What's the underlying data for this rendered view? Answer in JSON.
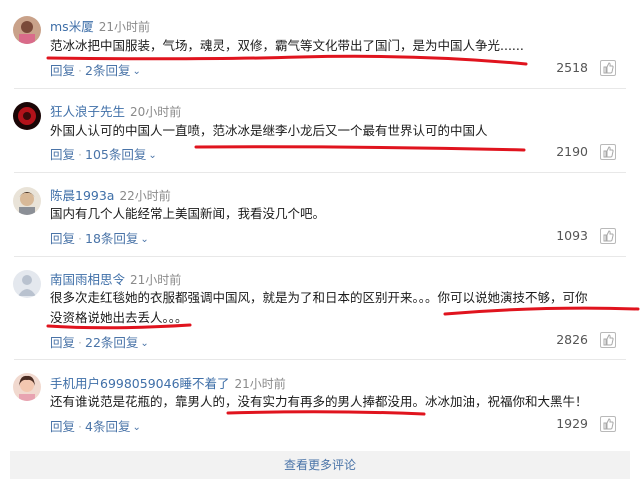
{
  "comments": [
    {
      "user": "ms米厦",
      "time": "21小时前",
      "text_lines": [
        "范冰冰把中国服装，气场，魂灵，双修，霸气等文化带出了国门，是为中国人争光......"
      ],
      "reply_label": "回复",
      "replies_label": "2条回复",
      "likes": "2518"
    },
    {
      "user": "狂人浪子先生",
      "time": "20小时前",
      "text_lines": [
        "外国人认可的中国人一直喷，范冰冰是继李小龙后又一个最有世界认可的中国人"
      ],
      "reply_label": "回复",
      "replies_label": "105条回复",
      "likes": "2190"
    },
    {
      "user": "陈晨1993a",
      "time": "22小时前",
      "text_lines": [
        "国内有几个人能经常上美国新闻，我看没几个吧。"
      ],
      "reply_label": "回复",
      "replies_label": "18条回复",
      "likes": "1093"
    },
    {
      "user": "南国雨相思令",
      "time": "21小时前",
      "text_lines": [
        "很多次走红毯她的衣服都强调中国风，就是为了和日本的区别开来。。。你可以说她演技不够，可你",
        "没资格说她出去丢人。。。"
      ],
      "reply_label": "回复",
      "replies_label": "22条回复",
      "likes": "2826"
    },
    {
      "user": "手机用户6998059046睡不着了",
      "time": "21小时前",
      "text_lines": [
        "还有谁说范是花瓶的，靠男人的，没有实力有再多的男人捧都没用。冰冰加油，祝福你和大黑牛！"
      ],
      "reply_label": "回复",
      "replies_label": "4条回复",
      "likes": "1929"
    }
  ],
  "more_label": "查看更多评论",
  "colors": {
    "link": "#3f6fa8",
    "annotation_red": "#e0141e"
  },
  "icons": [
    "chevron-down-icon",
    "thumb-up-icon",
    "avatar"
  ]
}
